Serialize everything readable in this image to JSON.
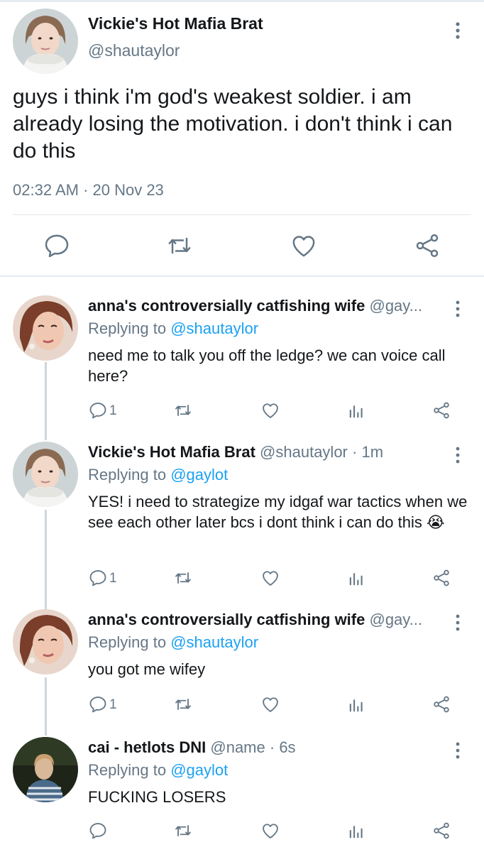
{
  "main_tweet": {
    "author_name": "Vickie's Hot Mafia Brat",
    "author_handle": "@shautaylor",
    "text": "guys i think i'm god's weakest soldier. i am already losing the motivation. i don't think i can do this",
    "timestamp": "02:32 AM · 20 Nov 23"
  },
  "replies": [
    {
      "author_name": "anna's controversially catfishing wife",
      "author_handle": "@gay...",
      "time": "",
      "replying_prefix": "Replying to",
      "replying_to": "@shautaylor",
      "text": "need me to talk you off the ledge? we can voice call here?",
      "reply_count": "1"
    },
    {
      "author_name": "Vickie's Hot Mafia Brat",
      "author_handle": "@shautaylor",
      "time": "· 1m",
      "replying_prefix": "Replying to",
      "replying_to": "@gaylot",
      "text": "YES! i need to strategize my idgaf war tactics when we see each other later bcs i dont think i can do this 😭",
      "reply_count": "1"
    },
    {
      "author_name": "anna's controversially catfishing wife",
      "author_handle": "@gay...",
      "time": "",
      "replying_prefix": "Replying to",
      "replying_to": "@shautaylor",
      "text": "you got me wifey",
      "reply_count": "1"
    },
    {
      "author_name": "cai - hetlots DNI",
      "author_handle": "@name",
      "time": "· 6s",
      "replying_prefix": "Replying to",
      "replying_to": "@gaylot",
      "text": "FUCKING LOSERS",
      "reply_count": ""
    }
  ],
  "icons": {
    "reply": "reply-icon",
    "retweet": "retweet-icon",
    "like": "like-icon",
    "share": "share-icon",
    "analytics": "analytics-icon",
    "more": "more-icon"
  },
  "colors": {
    "mention": "#1da1f2",
    "secondary_text": "#657786",
    "icon": "#657786",
    "thread_line": "#ccd6dd"
  }
}
